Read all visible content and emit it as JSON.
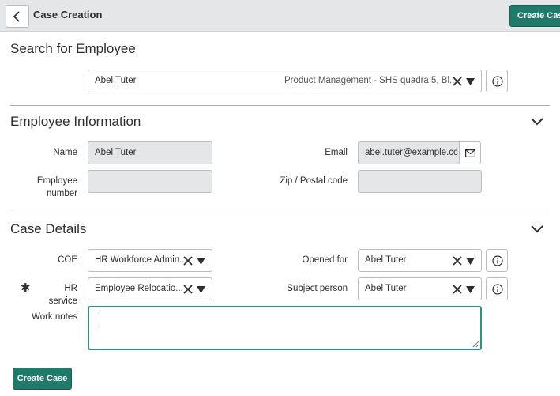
{
  "header": {
    "title": "Case Creation",
    "create_label": "Create Case"
  },
  "search": {
    "title": "Search for Employee",
    "employee": "Abel Tuter",
    "employee_detail": "Product Management - SHS quadra 5, Bl..."
  },
  "employee_info": {
    "title": "Employee Information",
    "name_label": "Name",
    "name_value": "Abel Tuter",
    "email_label": "Email",
    "email_value": "abel.tuter@example.cc",
    "employee_number_label": "Employee number",
    "employee_number_value": "",
    "zip_label": "Zip / Postal code",
    "zip_value": ""
  },
  "case_details": {
    "title": "Case Details",
    "coe_label": "COE",
    "coe_value": "HR Workforce Admin...",
    "opened_for_label": "Opened for",
    "opened_for_value": "Abel Tuter",
    "hr_service_label": "HR service",
    "hr_service_value": "Employee Relocatio...",
    "required_mark": "✱",
    "subject_person_label": "Subject person",
    "subject_person_value": "Abel Tuter",
    "work_notes_label": "Work notes",
    "work_notes_value": ""
  },
  "footer": {
    "create_label": "Create Case"
  },
  "colors": {
    "accent": "#1f7a6a",
    "header_bg": "#e4e6e7",
    "readonly_bg": "#e4e6e7",
    "focus_border": "#3a8c7c"
  }
}
